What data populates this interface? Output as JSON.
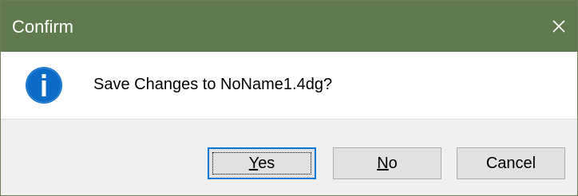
{
  "window": {
    "title": "Confirm",
    "close_icon": "close-icon",
    "titlebar_color": "#5f7a4f"
  },
  "message": {
    "icon": "info-icon",
    "icon_color": "#0a6cc7",
    "text": "Save Changes to NoName1.4dg?"
  },
  "buttons": {
    "yes": {
      "mnemonic": "Y",
      "rest": "es",
      "is_default": true
    },
    "no": {
      "mnemonic": "N",
      "rest": "o"
    },
    "cancel": {
      "label": "Cancel"
    }
  }
}
